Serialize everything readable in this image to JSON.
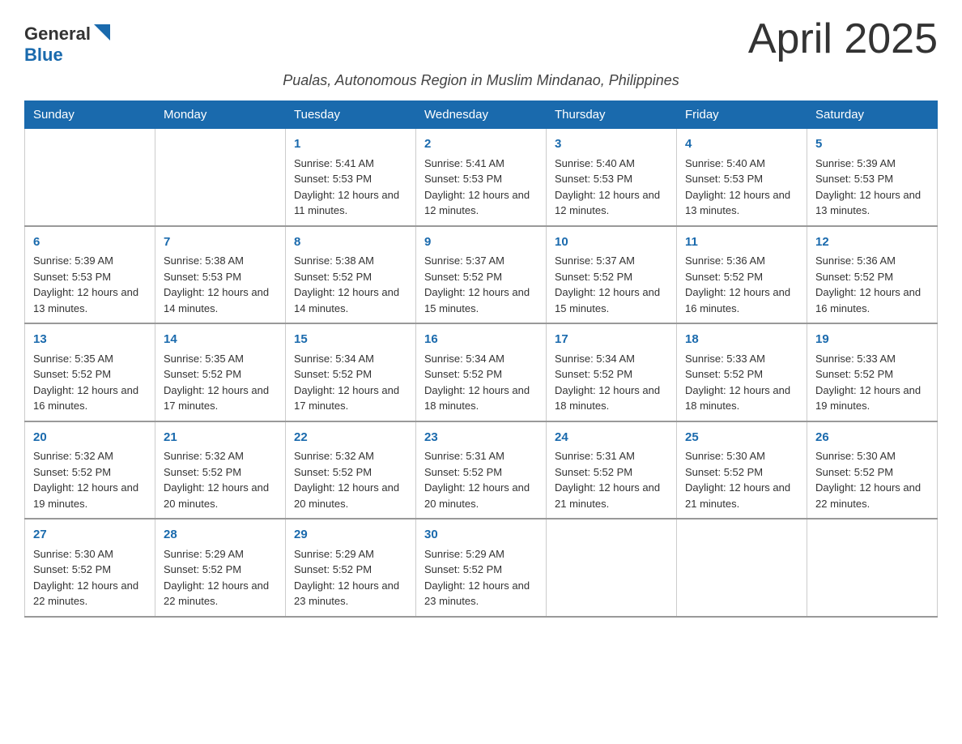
{
  "logo": {
    "line1": "General",
    "line2": "Blue"
  },
  "title": "April 2025",
  "subtitle": "Pualas, Autonomous Region in Muslim Mindanao, Philippines",
  "weekdays": [
    "Sunday",
    "Monday",
    "Tuesday",
    "Wednesday",
    "Thursday",
    "Friday",
    "Saturday"
  ],
  "weeks": [
    [
      {
        "day": "",
        "info": ""
      },
      {
        "day": "",
        "info": ""
      },
      {
        "day": "1",
        "info": "Sunrise: 5:41 AM\nSunset: 5:53 PM\nDaylight: 12 hours and 11 minutes."
      },
      {
        "day": "2",
        "info": "Sunrise: 5:41 AM\nSunset: 5:53 PM\nDaylight: 12 hours and 12 minutes."
      },
      {
        "day": "3",
        "info": "Sunrise: 5:40 AM\nSunset: 5:53 PM\nDaylight: 12 hours and 12 minutes."
      },
      {
        "day": "4",
        "info": "Sunrise: 5:40 AM\nSunset: 5:53 PM\nDaylight: 12 hours and 13 minutes."
      },
      {
        "day": "5",
        "info": "Sunrise: 5:39 AM\nSunset: 5:53 PM\nDaylight: 12 hours and 13 minutes."
      }
    ],
    [
      {
        "day": "6",
        "info": "Sunrise: 5:39 AM\nSunset: 5:53 PM\nDaylight: 12 hours and 13 minutes."
      },
      {
        "day": "7",
        "info": "Sunrise: 5:38 AM\nSunset: 5:53 PM\nDaylight: 12 hours and 14 minutes."
      },
      {
        "day": "8",
        "info": "Sunrise: 5:38 AM\nSunset: 5:52 PM\nDaylight: 12 hours and 14 minutes."
      },
      {
        "day": "9",
        "info": "Sunrise: 5:37 AM\nSunset: 5:52 PM\nDaylight: 12 hours and 15 minutes."
      },
      {
        "day": "10",
        "info": "Sunrise: 5:37 AM\nSunset: 5:52 PM\nDaylight: 12 hours and 15 minutes."
      },
      {
        "day": "11",
        "info": "Sunrise: 5:36 AM\nSunset: 5:52 PM\nDaylight: 12 hours and 16 minutes."
      },
      {
        "day": "12",
        "info": "Sunrise: 5:36 AM\nSunset: 5:52 PM\nDaylight: 12 hours and 16 minutes."
      }
    ],
    [
      {
        "day": "13",
        "info": "Sunrise: 5:35 AM\nSunset: 5:52 PM\nDaylight: 12 hours and 16 minutes."
      },
      {
        "day": "14",
        "info": "Sunrise: 5:35 AM\nSunset: 5:52 PM\nDaylight: 12 hours and 17 minutes."
      },
      {
        "day": "15",
        "info": "Sunrise: 5:34 AM\nSunset: 5:52 PM\nDaylight: 12 hours and 17 minutes."
      },
      {
        "day": "16",
        "info": "Sunrise: 5:34 AM\nSunset: 5:52 PM\nDaylight: 12 hours and 18 minutes."
      },
      {
        "day": "17",
        "info": "Sunrise: 5:34 AM\nSunset: 5:52 PM\nDaylight: 12 hours and 18 minutes."
      },
      {
        "day": "18",
        "info": "Sunrise: 5:33 AM\nSunset: 5:52 PM\nDaylight: 12 hours and 18 minutes."
      },
      {
        "day": "19",
        "info": "Sunrise: 5:33 AM\nSunset: 5:52 PM\nDaylight: 12 hours and 19 minutes."
      }
    ],
    [
      {
        "day": "20",
        "info": "Sunrise: 5:32 AM\nSunset: 5:52 PM\nDaylight: 12 hours and 19 minutes."
      },
      {
        "day": "21",
        "info": "Sunrise: 5:32 AM\nSunset: 5:52 PM\nDaylight: 12 hours and 20 minutes."
      },
      {
        "day": "22",
        "info": "Sunrise: 5:32 AM\nSunset: 5:52 PM\nDaylight: 12 hours and 20 minutes."
      },
      {
        "day": "23",
        "info": "Sunrise: 5:31 AM\nSunset: 5:52 PM\nDaylight: 12 hours and 20 minutes."
      },
      {
        "day": "24",
        "info": "Sunrise: 5:31 AM\nSunset: 5:52 PM\nDaylight: 12 hours and 21 minutes."
      },
      {
        "day": "25",
        "info": "Sunrise: 5:30 AM\nSunset: 5:52 PM\nDaylight: 12 hours and 21 minutes."
      },
      {
        "day": "26",
        "info": "Sunrise: 5:30 AM\nSunset: 5:52 PM\nDaylight: 12 hours and 22 minutes."
      }
    ],
    [
      {
        "day": "27",
        "info": "Sunrise: 5:30 AM\nSunset: 5:52 PM\nDaylight: 12 hours and 22 minutes."
      },
      {
        "day": "28",
        "info": "Sunrise: 5:29 AM\nSunset: 5:52 PM\nDaylight: 12 hours and 22 minutes."
      },
      {
        "day": "29",
        "info": "Sunrise: 5:29 AM\nSunset: 5:52 PM\nDaylight: 12 hours and 23 minutes."
      },
      {
        "day": "30",
        "info": "Sunrise: 5:29 AM\nSunset: 5:52 PM\nDaylight: 12 hours and 23 minutes."
      },
      {
        "day": "",
        "info": ""
      },
      {
        "day": "",
        "info": ""
      },
      {
        "day": "",
        "info": ""
      }
    ]
  ]
}
